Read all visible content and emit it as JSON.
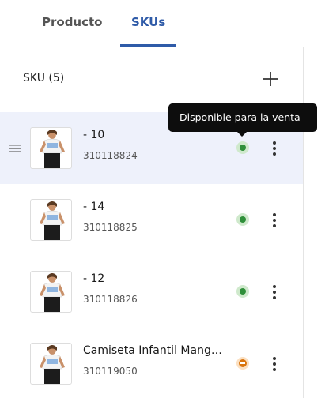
{
  "tabs": [
    {
      "label": "Producto",
      "active": false
    },
    {
      "label": "SKUs",
      "active": true
    }
  ],
  "accent_color": "#2f5ba8",
  "list": {
    "header": "SKU (5)",
    "add_icon": "plus-icon"
  },
  "tooltip": "Disponible para la venta",
  "skus": [
    {
      "name": "- 10",
      "code": "310118824",
      "status": "available",
      "selected": true
    },
    {
      "name": "- 14",
      "code": "310118825",
      "status": "available",
      "selected": false
    },
    {
      "name": "- 12",
      "code": "310118826",
      "status": "available",
      "selected": false
    },
    {
      "name": "Camiseta Infantil Manga Corta",
      "code": "310119050",
      "status": "pending",
      "selected": false
    }
  ],
  "status_colors": {
    "available": "#2f8f3a",
    "pending": "#d9750f"
  }
}
